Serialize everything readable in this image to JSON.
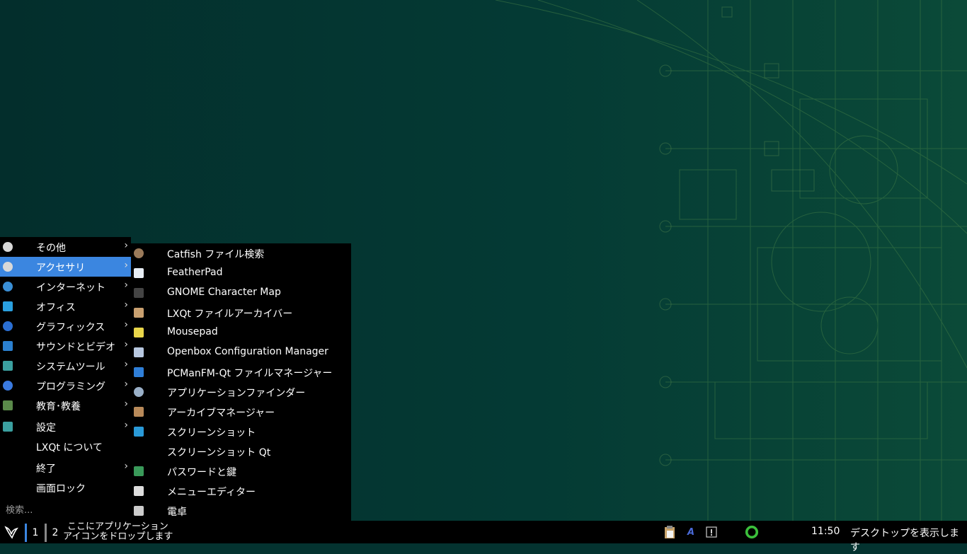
{
  "main_menu": {
    "items": [
      {
        "label": "その他",
        "has_submenu": true,
        "icon": "more-icon",
        "color": "#d8d8d8"
      },
      {
        "label": "アクセサリ",
        "has_submenu": true,
        "icon": "more-icon",
        "color": "#d8d8d8",
        "active": true
      },
      {
        "label": "インターネット",
        "has_submenu": true,
        "icon": "globe-icon",
        "color": "#3a8fd6"
      },
      {
        "label": "オフィス",
        "has_submenu": true,
        "icon": "office-icon",
        "color": "#2aa0e0"
      },
      {
        "label": "グラフィックス",
        "has_submenu": true,
        "icon": "graphics-icon",
        "color": "#2b6fd3"
      },
      {
        "label": "サウンドとビデオ",
        "has_submenu": true,
        "icon": "monitor-icon",
        "color": "#2b80d0"
      },
      {
        "label": "システムツール",
        "has_submenu": true,
        "icon": "system-tools-icon",
        "color": "#3ba0a0"
      },
      {
        "label": "プログラミング",
        "has_submenu": true,
        "icon": "programming-icon",
        "color": "#3a7ae0"
      },
      {
        "label": "教育･教養",
        "has_submenu": true,
        "icon": "education-icon",
        "color": "#5a8a4a"
      },
      {
        "label": "設定",
        "has_submenu": true,
        "icon": "settings-icon",
        "color": "#3ba0a0"
      },
      {
        "label": "LXQt について",
        "has_submenu": false,
        "icon": "",
        "color": ""
      },
      {
        "label": "終了",
        "has_submenu": true,
        "icon": "",
        "color": ""
      },
      {
        "label": "画面ロック",
        "has_submenu": false,
        "icon": "",
        "color": ""
      }
    ],
    "search_placeholder": "検索..."
  },
  "sub_menu": {
    "items": [
      {
        "label": "Catfish ファイル検索",
        "icon": "catfish-icon",
        "color": "#9a7a5a"
      },
      {
        "label": "FeatherPad",
        "icon": "featherpad-icon",
        "color": "#e8eef5"
      },
      {
        "label": "GNOME Character Map",
        "icon": "character-map-icon",
        "color": "#444444"
      },
      {
        "label": "LXQt ファイルアーカイバー",
        "icon": "archiver-icon",
        "color": "#c9a070"
      },
      {
        "label": "Mousepad",
        "icon": "mousepad-icon",
        "color": "#e9d64a"
      },
      {
        "label": "Openbox Configuration Manager",
        "icon": "openbox-icon",
        "color": "#b8c8e0"
      },
      {
        "label": "PCManFM-Qt ファイルマネージャー",
        "icon": "folder-icon",
        "color": "#2f7fd8"
      },
      {
        "label": "アプリケーションファインダー",
        "icon": "magnifier-icon",
        "color": "#9ab0c8"
      },
      {
        "label": "アーカイブマネージャー",
        "icon": "archive-manager-icon",
        "color": "#b88a5a"
      },
      {
        "label": "スクリーンショット",
        "icon": "screenshot-icon",
        "color": "#2a9ad8"
      },
      {
        "label": "スクリーンショット Qt",
        "icon": "",
        "color": ""
      },
      {
        "label": "パスワードと鍵",
        "icon": "password-keys-icon",
        "color": "#3a9a5a"
      },
      {
        "label": "メニューエディター",
        "icon": "menu-editor-icon",
        "color": "#dddddd"
      },
      {
        "label": "電卓",
        "icon": "calculator-icon",
        "color": "#cccccc"
      }
    ]
  },
  "taskbar": {
    "desktop_1": "1",
    "desktop_2": "2",
    "quicklaunch_line1": "ここにアプリケーション",
    "quicklaunch_line2": "アイコンをドロップします",
    "clock": "11:50",
    "show_desktop": "デスクトップを表示します",
    "tray_icons": [
      "clipboard-icon",
      "input-method-icon",
      "notification-icon",
      "network-ring-icon"
    ]
  },
  "colors": {
    "accent": "#3b86e0",
    "menu_bg": "#000000",
    "desktop_bg": "#043330"
  }
}
